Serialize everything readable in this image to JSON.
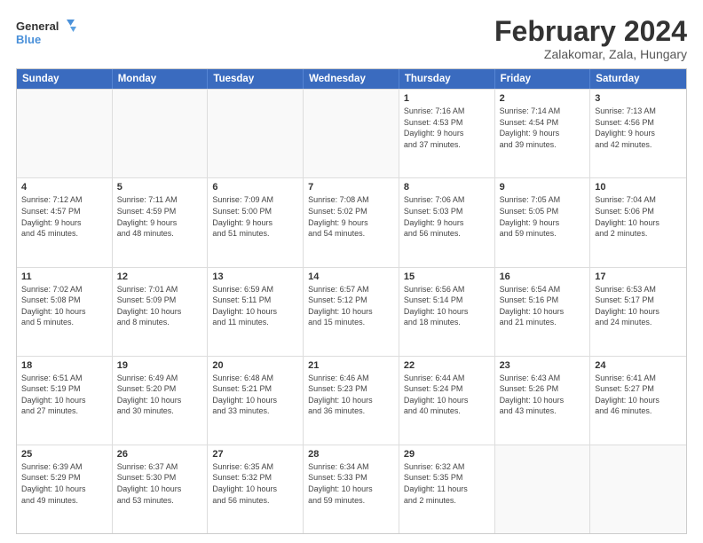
{
  "logo": {
    "line1": "General",
    "line2": "Blue"
  },
  "title": "February 2024",
  "subtitle": "Zalakomar, Zala, Hungary",
  "header_days": [
    "Sunday",
    "Monday",
    "Tuesday",
    "Wednesday",
    "Thursday",
    "Friday",
    "Saturday"
  ],
  "rows": [
    [
      {
        "day": "",
        "info": ""
      },
      {
        "day": "",
        "info": ""
      },
      {
        "day": "",
        "info": ""
      },
      {
        "day": "",
        "info": ""
      },
      {
        "day": "1",
        "info": "Sunrise: 7:16 AM\nSunset: 4:53 PM\nDaylight: 9 hours\nand 37 minutes."
      },
      {
        "day": "2",
        "info": "Sunrise: 7:14 AM\nSunset: 4:54 PM\nDaylight: 9 hours\nand 39 minutes."
      },
      {
        "day": "3",
        "info": "Sunrise: 7:13 AM\nSunset: 4:56 PM\nDaylight: 9 hours\nand 42 minutes."
      }
    ],
    [
      {
        "day": "4",
        "info": "Sunrise: 7:12 AM\nSunset: 4:57 PM\nDaylight: 9 hours\nand 45 minutes."
      },
      {
        "day": "5",
        "info": "Sunrise: 7:11 AM\nSunset: 4:59 PM\nDaylight: 9 hours\nand 48 minutes."
      },
      {
        "day": "6",
        "info": "Sunrise: 7:09 AM\nSunset: 5:00 PM\nDaylight: 9 hours\nand 51 minutes."
      },
      {
        "day": "7",
        "info": "Sunrise: 7:08 AM\nSunset: 5:02 PM\nDaylight: 9 hours\nand 54 minutes."
      },
      {
        "day": "8",
        "info": "Sunrise: 7:06 AM\nSunset: 5:03 PM\nDaylight: 9 hours\nand 56 minutes."
      },
      {
        "day": "9",
        "info": "Sunrise: 7:05 AM\nSunset: 5:05 PM\nDaylight: 9 hours\nand 59 minutes."
      },
      {
        "day": "10",
        "info": "Sunrise: 7:04 AM\nSunset: 5:06 PM\nDaylight: 10 hours\nand 2 minutes."
      }
    ],
    [
      {
        "day": "11",
        "info": "Sunrise: 7:02 AM\nSunset: 5:08 PM\nDaylight: 10 hours\nand 5 minutes."
      },
      {
        "day": "12",
        "info": "Sunrise: 7:01 AM\nSunset: 5:09 PM\nDaylight: 10 hours\nand 8 minutes."
      },
      {
        "day": "13",
        "info": "Sunrise: 6:59 AM\nSunset: 5:11 PM\nDaylight: 10 hours\nand 11 minutes."
      },
      {
        "day": "14",
        "info": "Sunrise: 6:57 AM\nSunset: 5:12 PM\nDaylight: 10 hours\nand 15 minutes."
      },
      {
        "day": "15",
        "info": "Sunrise: 6:56 AM\nSunset: 5:14 PM\nDaylight: 10 hours\nand 18 minutes."
      },
      {
        "day": "16",
        "info": "Sunrise: 6:54 AM\nSunset: 5:16 PM\nDaylight: 10 hours\nand 21 minutes."
      },
      {
        "day": "17",
        "info": "Sunrise: 6:53 AM\nSunset: 5:17 PM\nDaylight: 10 hours\nand 24 minutes."
      }
    ],
    [
      {
        "day": "18",
        "info": "Sunrise: 6:51 AM\nSunset: 5:19 PM\nDaylight: 10 hours\nand 27 minutes."
      },
      {
        "day": "19",
        "info": "Sunrise: 6:49 AM\nSunset: 5:20 PM\nDaylight: 10 hours\nand 30 minutes."
      },
      {
        "day": "20",
        "info": "Sunrise: 6:48 AM\nSunset: 5:21 PM\nDaylight: 10 hours\nand 33 minutes."
      },
      {
        "day": "21",
        "info": "Sunrise: 6:46 AM\nSunset: 5:23 PM\nDaylight: 10 hours\nand 36 minutes."
      },
      {
        "day": "22",
        "info": "Sunrise: 6:44 AM\nSunset: 5:24 PM\nDaylight: 10 hours\nand 40 minutes."
      },
      {
        "day": "23",
        "info": "Sunrise: 6:43 AM\nSunset: 5:26 PM\nDaylight: 10 hours\nand 43 minutes."
      },
      {
        "day": "24",
        "info": "Sunrise: 6:41 AM\nSunset: 5:27 PM\nDaylight: 10 hours\nand 46 minutes."
      }
    ],
    [
      {
        "day": "25",
        "info": "Sunrise: 6:39 AM\nSunset: 5:29 PM\nDaylight: 10 hours\nand 49 minutes."
      },
      {
        "day": "26",
        "info": "Sunrise: 6:37 AM\nSunset: 5:30 PM\nDaylight: 10 hours\nand 53 minutes."
      },
      {
        "day": "27",
        "info": "Sunrise: 6:35 AM\nSunset: 5:32 PM\nDaylight: 10 hours\nand 56 minutes."
      },
      {
        "day": "28",
        "info": "Sunrise: 6:34 AM\nSunset: 5:33 PM\nDaylight: 10 hours\nand 59 minutes."
      },
      {
        "day": "29",
        "info": "Sunrise: 6:32 AM\nSunset: 5:35 PM\nDaylight: 11 hours\nand 2 minutes."
      },
      {
        "day": "",
        "info": ""
      },
      {
        "day": "",
        "info": ""
      }
    ]
  ]
}
